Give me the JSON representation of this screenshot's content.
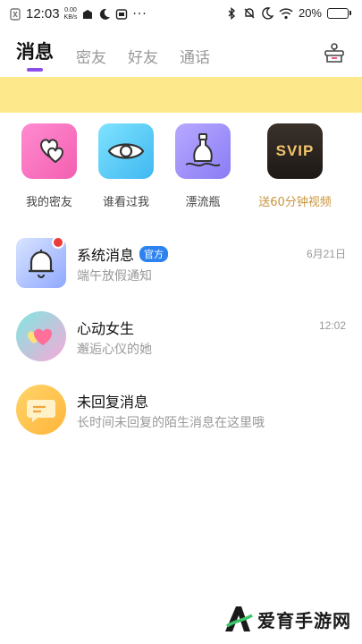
{
  "statusbar": {
    "time": "12:03",
    "speed_value": "0.00",
    "speed_unit": "KB/s",
    "battery": "20%",
    "battery_level": 0.2
  },
  "tabs": [
    {
      "label": "消息",
      "active": true
    },
    {
      "label": "密友",
      "active": false
    },
    {
      "label": "好友",
      "active": false
    },
    {
      "label": "通话",
      "active": false
    }
  ],
  "quick_entries": [
    {
      "label": "我的密友",
      "icon": "hearts-icon",
      "color": "#f35fb0"
    },
    {
      "label": "谁看过我",
      "icon": "eye-icon",
      "color": "#3fb8f0"
    },
    {
      "label": "漂流瓶",
      "icon": "bottle-icon",
      "color": "#8a7cf5"
    },
    {
      "label": "送60分钟视频",
      "icon": "svip-icon",
      "color": "#c8953c",
      "badge_text": "SVIP"
    }
  ],
  "messages": [
    {
      "title": "系统消息",
      "badge": "官方",
      "subtitle": "端午放假通知",
      "time": "6月21日",
      "icon": "bell-icon",
      "unread": true
    },
    {
      "title": "心动女生",
      "subtitle": "邂逅心仪的她",
      "time": "12:02",
      "icon": "hearts-icon"
    },
    {
      "title": "未回复消息",
      "subtitle": "长时间未回复的陌生消息在这里哦",
      "time": "",
      "icon": "chat-bubble-icon"
    }
  ],
  "watermark": {
    "text": "爱育手游网"
  }
}
